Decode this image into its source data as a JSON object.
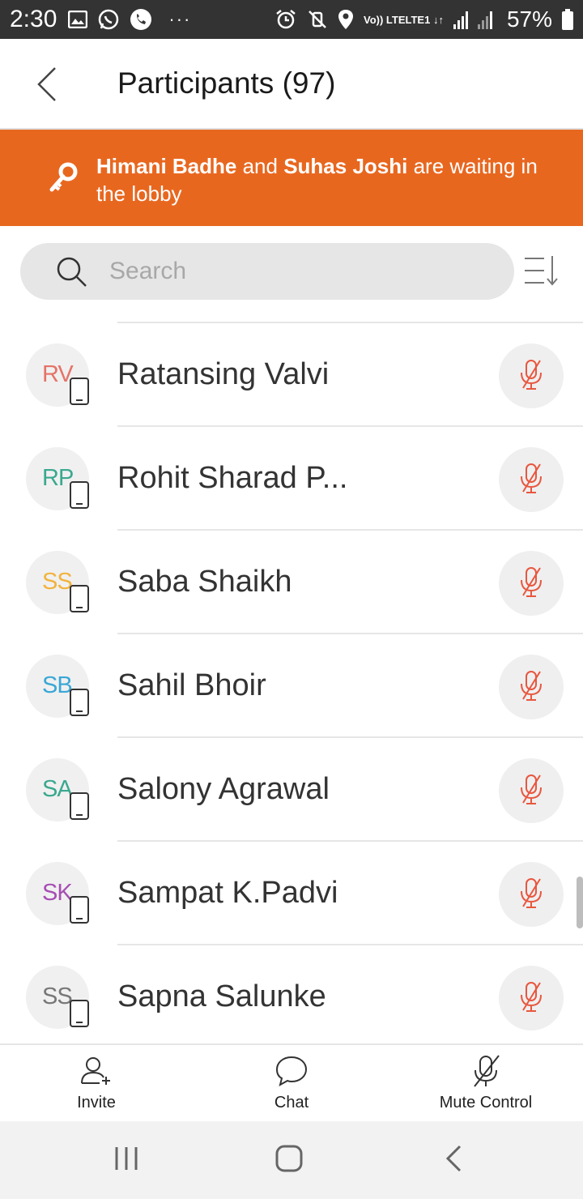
{
  "status_bar": {
    "time": "2:30",
    "network": "Vo)) LTE",
    "network_sub": "LTE1 ↓↑",
    "battery": "57%",
    "overflow": "···"
  },
  "header": {
    "title": "Participants (97)",
    "back_icon": "chevron-left-icon"
  },
  "lobby": {
    "name1": "Himani Badhe",
    "connector": " and ",
    "name2": "Suhas Joshi",
    "suffix": " are waiting in the lobby",
    "icon": "key-icon"
  },
  "search": {
    "placeholder": "Search",
    "value": ""
  },
  "participants": [
    {
      "initials": "",
      "name": "",
      "color": "#999999"
    },
    {
      "initials": "RV",
      "name": "Ratansing Valvi",
      "color": "#e57368"
    },
    {
      "initials": "RP",
      "name": "Rohit Sharad P...",
      "color": "#3aa88f"
    },
    {
      "initials": "SS",
      "name": "Saba Shaikh",
      "color": "#f2b33d"
    },
    {
      "initials": "SB",
      "name": "Sahil Bhoir",
      "color": "#3aa7d6"
    },
    {
      "initials": "SA",
      "name": "Salony Agrawal",
      "color": "#3aa88f"
    },
    {
      "initials": "SK",
      "name": "Sampat K.Padvi",
      "color": "#a64fb3"
    },
    {
      "initials": "SS",
      "name": "Sapna Salunke",
      "color": "#777777"
    }
  ],
  "toolbar": {
    "invite_label": "Invite",
    "chat_label": "Chat",
    "mute_control_label": "Mute Control"
  },
  "colors": {
    "accent": "#e8671f",
    "muted_mic": "#e8573f"
  }
}
